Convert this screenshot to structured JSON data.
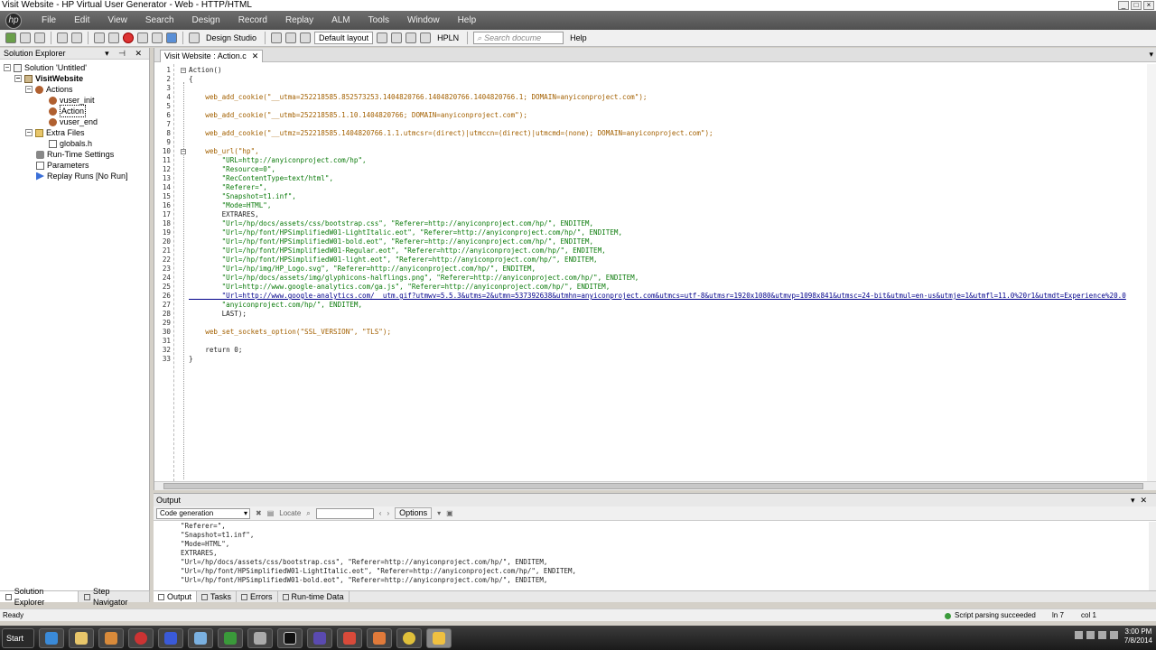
{
  "window": {
    "title": "Visit Website - HP Virtual User Generator - Web - HTTP/HTML"
  },
  "menu": [
    "File",
    "Edit",
    "View",
    "Search",
    "Design",
    "Record",
    "Replay",
    "ALM",
    "Tools",
    "Window",
    "Help"
  ],
  "toolbar": {
    "design_studio": "Design Studio",
    "layout": "Default layout",
    "hpln": "HPLN",
    "search_placeholder": "Search docume",
    "help": "Help"
  },
  "solution_explorer": {
    "title": "Solution Explorer",
    "solution": "Solution 'Untitled'",
    "script": "VisitWebsite",
    "actions_folder": "Actions",
    "actions": [
      "vuser_init",
      "Action",
      "vuser_end"
    ],
    "extra_files": "Extra Files",
    "extra": [
      "globals.h"
    ],
    "runtime_settings": "Run-Time Settings",
    "parameters": "Parameters",
    "replay_runs": "Replay Runs [No Run]"
  },
  "left_tabs": [
    "Solution Explorer",
    "Step Navigator"
  ],
  "editor": {
    "tab": "Visit Website : Action.c",
    "lines": [
      {
        "n": "1",
        "t": "Action()",
        "c": "plain",
        "fold": true
      },
      {
        "n": "2",
        "t": "{",
        "c": "plain"
      },
      {
        "n": "3",
        "t": "",
        "c": "plain"
      },
      {
        "n": "4",
        "t": "    web_add_cookie(\"__utma=252218585.852573253.1404820766.1404820766.1404820766.1; DOMAIN=anyiconproject.com\");",
        "c": "func"
      },
      {
        "n": "5",
        "t": "",
        "c": "plain"
      },
      {
        "n": "6",
        "t": "    web_add_cookie(\"__utmb=252218585.1.10.1404820766; DOMAIN=anyiconproject.com\");",
        "c": "func"
      },
      {
        "n": "7",
        "t": "",
        "c": "plain"
      },
      {
        "n": "8",
        "t": "    web_add_cookie(\"__utmz=252218585.1404820766.1.1.utmcsr=(direct)|utmccn=(direct)|utmcmd=(none); DOMAIN=anyiconproject.com\");",
        "c": "func"
      },
      {
        "n": "9",
        "t": "",
        "c": "plain"
      },
      {
        "n": "10",
        "t": "    web_url(\"hp\",",
        "c": "func",
        "fold": true
      },
      {
        "n": "11",
        "t": "        \"URL=http://anyiconproject.com/hp\",",
        "c": "str"
      },
      {
        "n": "12",
        "t": "        \"Resource=0\",",
        "c": "str"
      },
      {
        "n": "13",
        "t": "        \"RecContentType=text/html\",",
        "c": "str"
      },
      {
        "n": "14",
        "t": "        \"Referer=\",",
        "c": "str"
      },
      {
        "n": "15",
        "t": "        \"Snapshot=t1.inf\",",
        "c": "str"
      },
      {
        "n": "16",
        "t": "        \"Mode=HTML\",",
        "c": "str"
      },
      {
        "n": "17",
        "t": "        EXTRARES,",
        "c": "plain"
      },
      {
        "n": "18",
        "t": "        \"Url=/hp/docs/assets/css/bootstrap.css\", \"Referer=http://anyiconproject.com/hp/\", ENDITEM,",
        "c": "str"
      },
      {
        "n": "19",
        "t": "        \"Url=/hp/font/HPSimplifiedW01-LightItalic.eot\", \"Referer=http://anyiconproject.com/hp/\", ENDITEM,",
        "c": "str"
      },
      {
        "n": "20",
        "t": "        \"Url=/hp/font/HPSimplifiedW01-bold.eot\", \"Referer=http://anyiconproject.com/hp/\", ENDITEM,",
        "c": "str"
      },
      {
        "n": "21",
        "t": "        \"Url=/hp/font/HPSimplifiedW01-Regular.eot\", \"Referer=http://anyiconproject.com/hp/\", ENDITEM,",
        "c": "str"
      },
      {
        "n": "22",
        "t": "        \"Url=/hp/font/HPSimplifiedW01-light.eot\", \"Referer=http://anyiconproject.com/hp/\", ENDITEM,",
        "c": "str"
      },
      {
        "n": "23",
        "t": "        \"Url=/hp/img/HP_Logo.svg\", \"Referer=http://anyiconproject.com/hp/\", ENDITEM,",
        "c": "str"
      },
      {
        "n": "24",
        "t": "        \"Url=/hp/docs/assets/img/glyphicons-halflings.png\", \"Referer=http://anyiconproject.com/hp/\", ENDITEM,",
        "c": "str"
      },
      {
        "n": "25",
        "t": "        \"Url=http://www.google-analytics.com/ga.js\", \"Referer=http://anyiconproject.com/hp/\", ENDITEM,",
        "c": "str"
      },
      {
        "n": "26",
        "t": "        \"Url=http://www.google-analytics.com/__utm.gif?utmwv=5.5.3&utms=2&utmn=537392638&utmhn=anyiconproject.com&utmcs=utf-8&utmsr=1920x1080&utmvp=1098x841&utmsc=24-bit&utmul=en-us&utmje=1&utmfl=11.0%20r1&utmdt=Experience%20.0",
        "c": "link"
      },
      {
        "n": "27",
        "t": "        \"anyiconproject.com/hp/\", ENDITEM,",
        "c": "str"
      },
      {
        "n": "28",
        "t": "        LAST);",
        "c": "plain"
      },
      {
        "n": "29",
        "t": "",
        "c": "plain"
      },
      {
        "n": "30",
        "t": "    web_set_sockets_option(\"SSL_VERSION\", \"TLS\");",
        "c": "func"
      },
      {
        "n": "31",
        "t": "",
        "c": "plain"
      },
      {
        "n": "32",
        "t": "    return 0;",
        "c": "plain"
      },
      {
        "n": "33",
        "t": "}",
        "c": "plain"
      }
    ]
  },
  "output": {
    "title": "Output",
    "filter": "Code generation",
    "locate": "Locate",
    "options": "Options",
    "lines": [
      "    \"Referer=\",",
      "    \"Snapshot=t1.inf\",",
      "    \"Mode=HTML\",",
      "    EXTRARES,",
      "    \"Url=/hp/docs/assets/css/bootstrap.css\", \"Referer=http://anyiconproject.com/hp/\", ENDITEM,",
      "    \"Url=/hp/font/HPSimplifiedW01-LightItalic.eot\", \"Referer=http://anyiconproject.com/hp/\", ENDITEM,",
      "    \"Url=/hp/font/HPSimplifiedW01-bold.eot\", \"Referer=http://anyiconproject.com/hp/\", ENDITEM,"
    ]
  },
  "bottom_tabs": [
    "Output",
    "Tasks",
    "Errors",
    "Run-time Data"
  ],
  "status": {
    "ready": "Ready",
    "parse": "Script parsing succeeded",
    "ln": "ln 7",
    "col": "col 1"
  },
  "taskbar": {
    "start": "Start",
    "time": "3:00 PM",
    "date": "7/8/2014"
  }
}
